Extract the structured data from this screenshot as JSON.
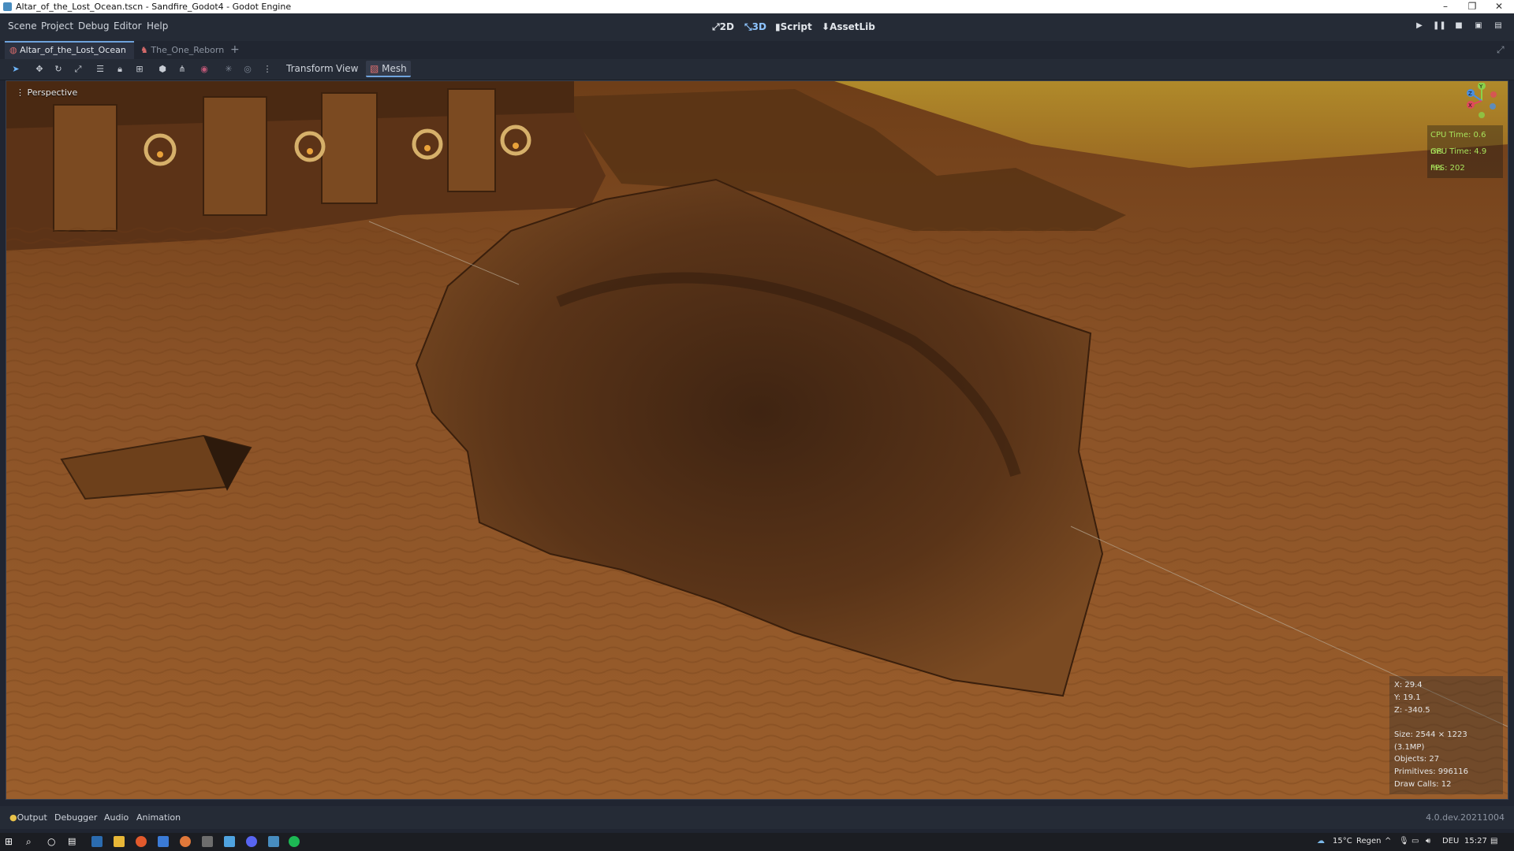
{
  "window": {
    "title": "Altar_of_the_Lost_Ocean.tscn - Sandfire_Godot4 - Godot Engine",
    "controls": [
      "–",
      "❐",
      "✕"
    ]
  },
  "menu": {
    "items": [
      "Scene",
      "Project",
      "Debug",
      "Editor",
      "Help"
    ]
  },
  "main_screens": [
    {
      "icon": "2d-icon",
      "label": "2D"
    },
    {
      "icon": "3d-icon",
      "label": "3D"
    },
    {
      "icon": "script-icon",
      "label": "Script"
    },
    {
      "icon": "assetlib-icon",
      "label": "AssetLib"
    }
  ],
  "run_controls": [
    "play-icon",
    "pause-icon",
    "stop-icon",
    "play-scene-icon",
    "play-custom-icon"
  ],
  "tabs": [
    {
      "label": "Altar_of_the_Lost_Ocean",
      "active": true
    },
    {
      "label": "The_One_Reborn",
      "active": false
    }
  ],
  "toolbar": {
    "tools": [
      "select-icon",
      "move-icon",
      "rotate-icon",
      "scale-icon",
      "list-select-icon",
      "lock-icon",
      "group-icon",
      "local-space-icon",
      "snap-icon",
      "camera-icon",
      "sun-icon",
      "environment-icon",
      "more-icon"
    ],
    "menus": [
      "Transform",
      "View"
    ],
    "mesh_label": "Mesh"
  },
  "viewport": {
    "label": "Perspective",
    "perf": {
      "cpu": "CPU Time: 0.6 ms",
      "gpu": "GPU Time: 4.9 ms",
      "fps": "FPS: 202"
    },
    "gizmo": {
      "y": "Y",
      "z": "Z",
      "x": "X"
    },
    "info": {
      "x": "X: 29.4",
      "y": "Y: 19.1",
      "z": "Z: -340.5",
      "size": "Size: 2544 × 1223 (3.1MP)",
      "objects": "Objects: 27",
      "primitives": "Primitives: 996116",
      "draw_calls": "Draw Calls: 12"
    }
  },
  "bottom_panel": {
    "tabs": [
      "Output",
      "Debugger",
      "Audio",
      "Animation"
    ],
    "version": "4.0.dev.20211004"
  },
  "taskbar": {
    "weather": "15°C",
    "weather_text": "Regen",
    "lang": "DEU",
    "time": "15:27"
  },
  "colors": {
    "accent": "#6fa3dc",
    "perf_text": "#a8e35b",
    "sand": "#8a5426",
    "sky": "#a0791f"
  }
}
